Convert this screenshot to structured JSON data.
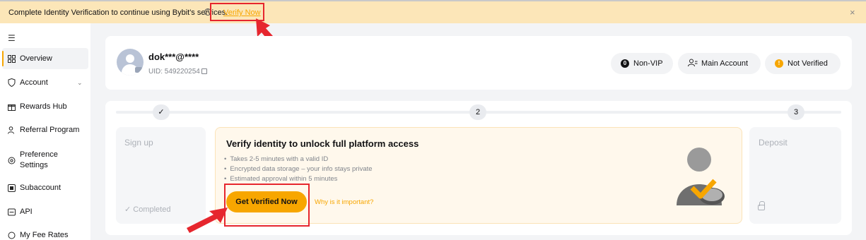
{
  "banner": {
    "message": "Complete Identity Verification to continue using Bybit's services.",
    "help_icon": "?",
    "verify_link": "Verify Now",
    "close": "×"
  },
  "sidebar": {
    "collapse_icon": "☰",
    "items": [
      {
        "label": "Overview",
        "icon": "grid-icon",
        "active": true
      },
      {
        "label": "Account",
        "icon": "shield-icon",
        "has_chevron": true
      },
      {
        "label": "Rewards Hub",
        "icon": "gift-icon"
      },
      {
        "label": "Referral Program",
        "icon": "user-plus-icon"
      },
      {
        "label": "Preference Settings",
        "icon": "settings-icon"
      },
      {
        "label": "Subaccount",
        "icon": "subaccount-icon"
      },
      {
        "label": "API",
        "icon": "api-icon"
      },
      {
        "label": "My Fee Rates",
        "icon": "fee-icon"
      }
    ]
  },
  "profile": {
    "username": "dok***@****",
    "uid": "UID: 549220254",
    "badges": {
      "vip": "Non-VIP",
      "vip_icon": "0",
      "account": "Main Account",
      "verification": "Not Verified",
      "verification_icon": "!"
    }
  },
  "steps": {
    "step1_icon": "✓",
    "step2": "2",
    "step3": "3",
    "signup": {
      "title": "Sign up",
      "status": "✓ Completed"
    },
    "verify": {
      "heading": "Verify identity to unlock full platform access",
      "bullets": [
        "Takes 2-5 minutes with a valid ID",
        "Encrypted data storage – your info stays private",
        "Estimated approval within 5 minutes"
      ],
      "button": "Get Verified Now",
      "why_link": "Why is it important?"
    },
    "deposit": {
      "title": "Deposit"
    }
  },
  "colors": {
    "accent": "#f7a600",
    "banner_bg": "#fce6b8",
    "highlight_red": "#e6262e"
  }
}
